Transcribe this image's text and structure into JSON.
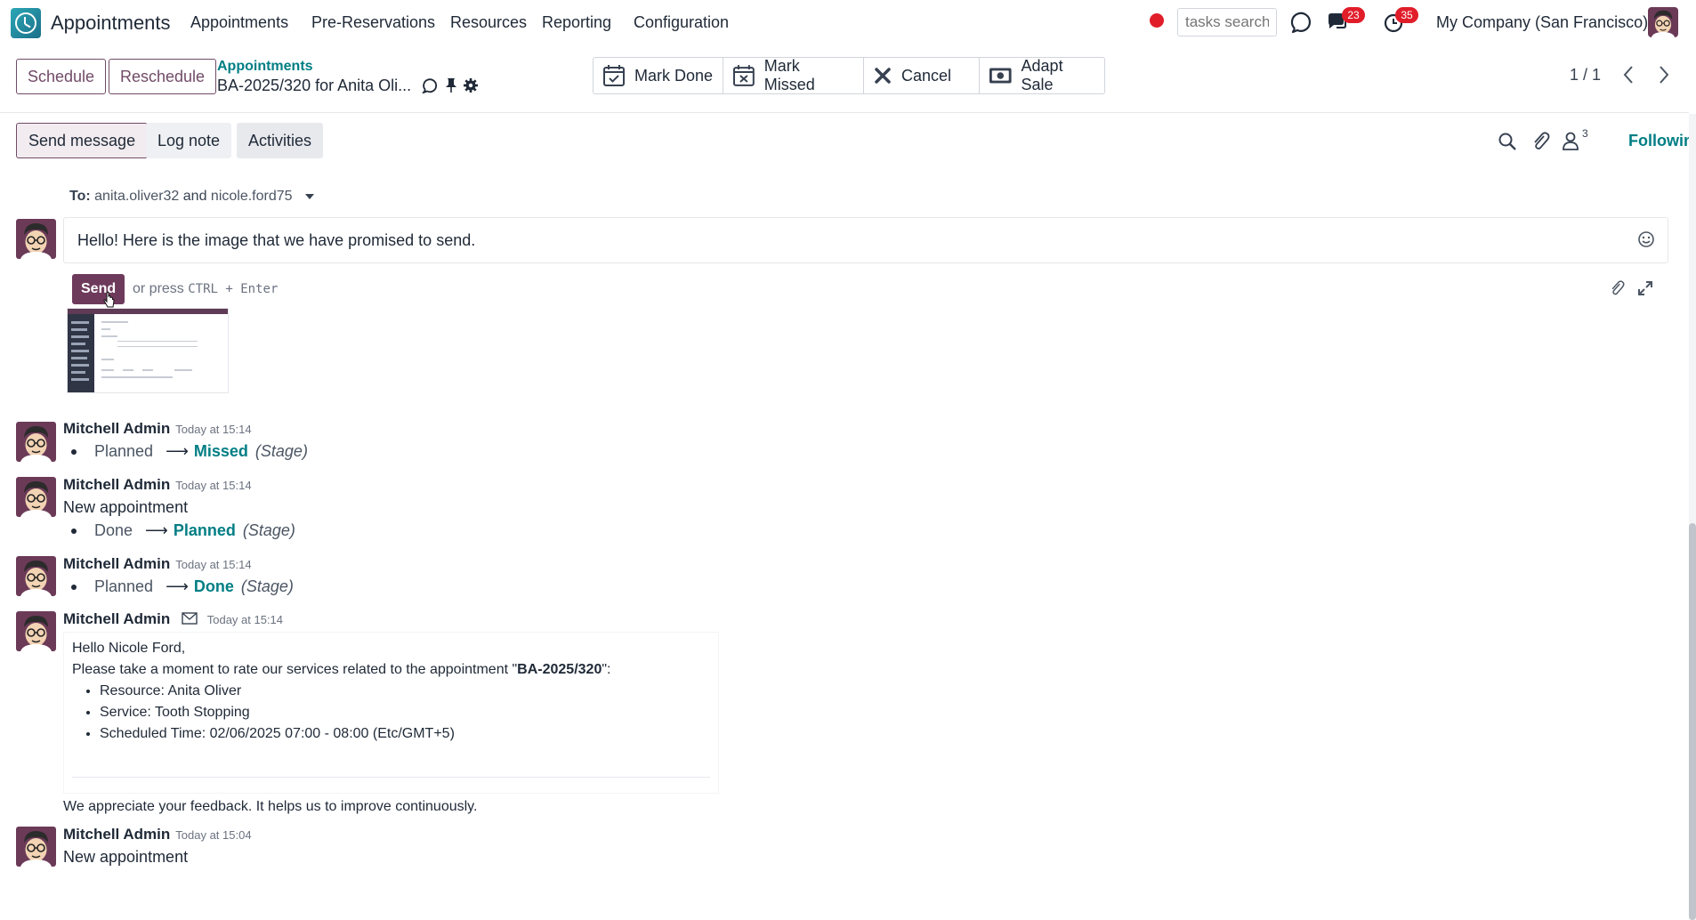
{
  "nav": {
    "app_title": "Appointments",
    "menu": [
      "Appointments",
      "Pre-Reservations",
      "Resources",
      "Reporting",
      "Configuration"
    ],
    "search_placeholder": "tasks search",
    "messages_badge": "23",
    "activities_badge": "35",
    "company": "My Company (San Francisco)"
  },
  "control": {
    "schedule_label": "Schedule",
    "reschedule_label": "Reschedule",
    "breadcrumb_parent": "Appointments",
    "breadcrumb_current": "BA-2025/320 for Anita Oli...",
    "actions": [
      "Mark Done",
      "Mark Missed",
      "Cancel",
      "Adapt Sale"
    ],
    "pager": "1 / 1"
  },
  "chatter": {
    "tabs": [
      "Send message",
      "Log note",
      "Activities"
    ],
    "followers_count": "3",
    "following_label": "Following",
    "to_label": "To:",
    "recipient_1": "anita.oliver32",
    "and_word": "and",
    "recipient_2": "nicole.ford75",
    "composer_text": "Hello! Here is the image that we have promised to send.",
    "send_label": "Send",
    "hint_prefix": "or press",
    "hint_keys": "CTRL + Enter"
  },
  "messages": [
    {
      "author": "Mitchell Admin",
      "time": "Today at 15:14",
      "old": "Planned",
      "new": "Missed",
      "field": "(Stage)"
    },
    {
      "author": "Mitchell Admin",
      "time": "Today at 15:14",
      "body": "New appointment",
      "old": "Done",
      "new": "Planned",
      "field": "(Stage)"
    },
    {
      "author": "Mitchell Admin",
      "time": "Today at 15:14",
      "old": "Planned",
      "new": "Done",
      "field": "(Stage)"
    },
    {
      "author": "Mitchell Admin",
      "time": "Today at 15:14",
      "greeting": "Hello Nicole Ford,",
      "intro_prefix": "Please take a moment to rate our services related to the appointment \"",
      "intro_ref": "BA-2025/320",
      "intro_suffix": "\":",
      "items": [
        "Resource: Anita Oliver",
        "Service: Tooth Stopping",
        "Scheduled Time: 02/06/2025 07:00 - 08:00 (Etc/GMT+5)"
      ],
      "feedback": "We appreciate your feedback. It helps us to improve continuously."
    },
    {
      "author": "Mitchell Admin",
      "time": "Today at 15:04",
      "body": "New appointment"
    }
  ],
  "colors": {
    "brand": "#714b67",
    "accent": "#017e84",
    "badge": "#e11d2a"
  }
}
